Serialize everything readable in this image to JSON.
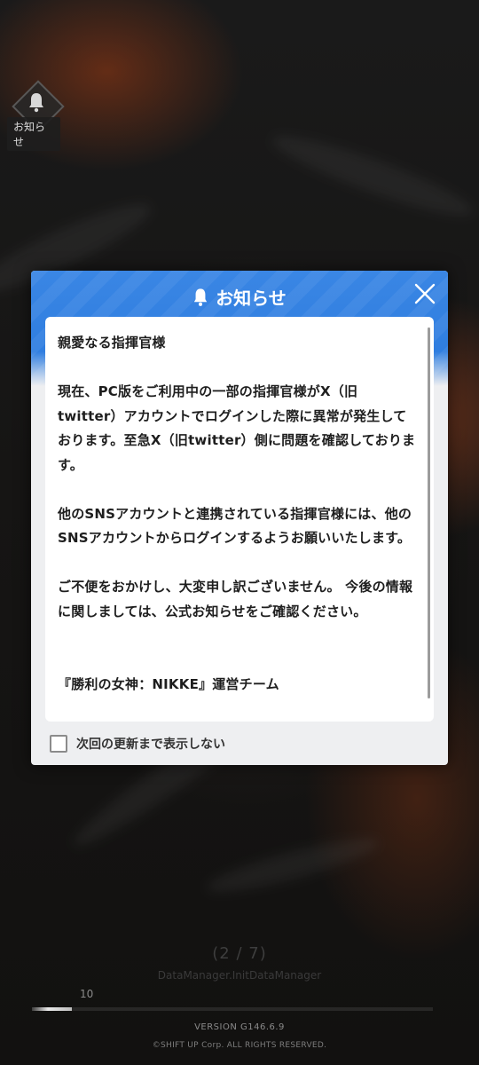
{
  "notification_badge": {
    "label": "お知らせ",
    "icon": "bell-icon"
  },
  "modal": {
    "title": "お知らせ",
    "title_icon": "bell-icon",
    "close_icon": "close-icon",
    "body": {
      "greeting": "親愛なる指揮官様",
      "paragraph1": "現在、PC版をご利用中の一部の指揮官様がX（旧twitter）アカウントでログインした際に異常が発生しております。至急X（旧twitter）側に問題を確認しております。",
      "paragraph2": "他のSNSアカウントと連携されている指揮官様には、他のSNSアカウントからログインするようお願いいたします。",
      "paragraph3": "ご不便をおかけし、大変申し訳ございません。 今後の情報に関しましては、公式お知らせをご確認ください。",
      "signature": "『勝利の女神：NIKKE』運営チーム"
    },
    "checkbox_label": "次回の更新まで表示しない",
    "checkbox_checked": false,
    "accent_color": "#2f7ee0"
  },
  "loading": {
    "step_text": "(2 / 7)",
    "status_text": "DataManager.InitDataManager",
    "percent_text": "10",
    "progress": 0.1
  },
  "footer": {
    "version": "VERSION   G146.6.9",
    "copyright": "©SHIFT UP Corp. ALL RIGHTS  RESERVED."
  }
}
